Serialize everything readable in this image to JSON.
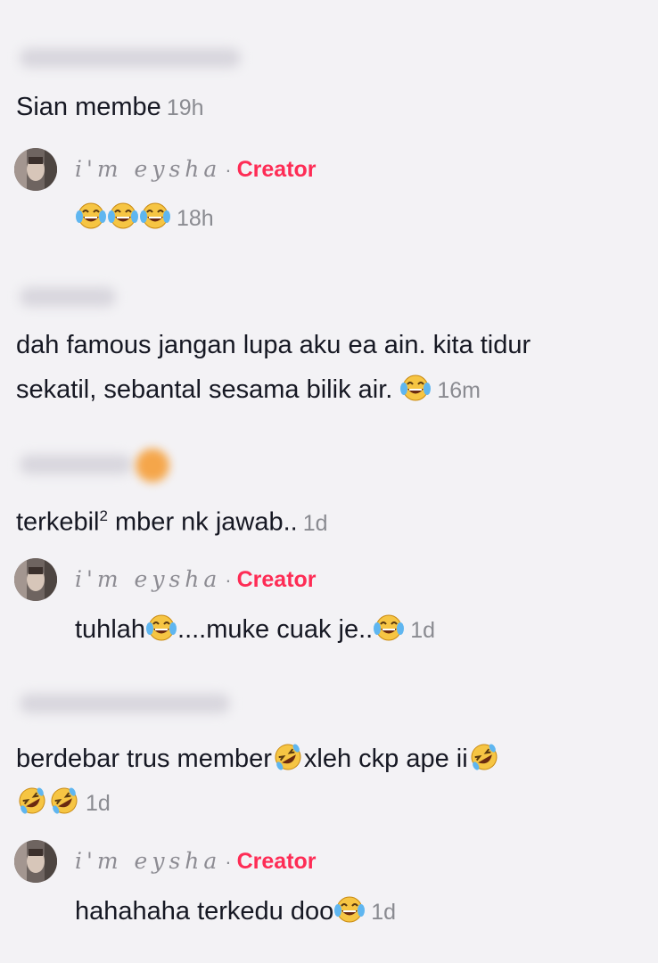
{
  "comments": [
    {
      "text": "Sian membe",
      "time": "19h",
      "reply": {
        "author": "i'm eysha",
        "separator": "·",
        "badge": "Creator",
        "text": "",
        "time": "18h"
      }
    },
    {
      "text_line1": "dah famous jangan lupa aku ea ain. kita tidur",
      "text_line2": "sekatil, sebantal sesama bilik air.",
      "time": "16m"
    },
    {
      "text": "terkebil",
      "sup": "2",
      "text_after": " mber nk jawab..",
      "time": "1d",
      "reply": {
        "author": "i'm eysha",
        "separator": "·",
        "badge": "Creator",
        "text_before": "tuhlah",
        "text_after": "....muke cuak je..",
        "time": "1d"
      }
    },
    {
      "text_part1": "berdebar trus member",
      "text_part2": "xleh ckp ape ii",
      "time": "1d",
      "reply": {
        "author": "i'm eysha",
        "separator": "·",
        "badge": "Creator",
        "text": "hahahaha terkedu doo",
        "time": "1d"
      }
    }
  ],
  "emoji_icons": [
    "laughing-tears-emoji",
    "rofl-emoji"
  ],
  "colors": {
    "creator_badge": "#fe2c55",
    "timestamp": "#8a8b91",
    "background": "#f3f2f5"
  }
}
